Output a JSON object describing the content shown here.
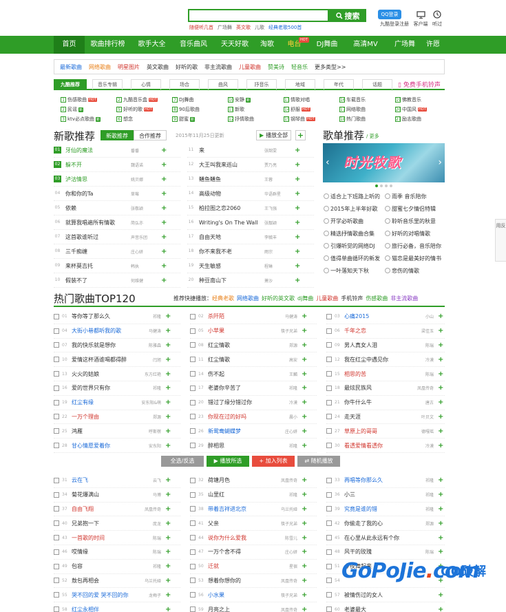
{
  "header": {
    "search_placeholder": "",
    "search_label": "搜索",
    "hot_words": [
      {
        "label": "随便听几首",
        "color": "red"
      },
      {
        "label": "广场舞",
        "color": "gray"
      },
      {
        "label": "英文歌",
        "color": "red"
      },
      {
        "label": "儿歌",
        "color": "gray"
      },
      {
        "label": "经典老歌500首",
        "color": "blue"
      }
    ],
    "qq_btn": "QQ登录",
    "tools": [
      {
        "top": "",
        "label": "九酷登录"
      },
      {
        "top": "",
        "label": "注册"
      },
      {
        "top": "",
        "label": "客户端"
      },
      {
        "top": "",
        "label": "听过"
      }
    ]
  },
  "nav": {
    "items": [
      "首页",
      "歌曲排行榜",
      "歌手大全",
      "音乐曲风",
      "天天好歌",
      "淘歌",
      "电台",
      "DJ舞曲",
      "高清MV",
      "广场舞",
      "许愿"
    ],
    "hot_label": "HOT"
  },
  "category_bar": [
    {
      "label": "最新歌曲",
      "color": "blue"
    },
    {
      "label": "网络歌曲",
      "color": "orange"
    },
    {
      "label": "明星图片",
      "color": "red"
    },
    {
      "label": "英文歌曲",
      "color": "gray"
    },
    {
      "label": "好听的歌",
      "color": "gray"
    },
    {
      "label": "非主流歌曲",
      "color": "gray"
    },
    {
      "label": "儿童歌曲",
      "color": "red"
    },
    {
      "label": "赞美诗",
      "color": "green"
    },
    {
      "label": "轻音乐",
      "color": "green"
    },
    {
      "label": "更多类型>>",
      "color": "gray"
    }
  ],
  "sub_tabs": [
    "九酷推荐",
    "音乐专辑",
    "心情",
    "场合",
    "曲风",
    "抒音乐",
    "地域",
    "年代",
    "话题"
  ],
  "phone_ring": "免费手机铃声",
  "channels": [
    [
      "1",
      "伤感歌曲",
      "tag",
      "",
      "2",
      "九酷音乐盒",
      "tag",
      "",
      "7",
      "DJ舞曲",
      "",
      "",
      "10",
      "安静",
      "g",
      "",
      "13",
      "情歌对唱",
      "",
      "",
      "16",
      "车载音乐",
      "",
      "",
      "19",
      "佛教音乐",
      "",
      ""
    ],
    [
      "2",
      "民谣",
      "g",
      "",
      "5",
      "好听的歌",
      "tag",
      "",
      "8",
      "90后歌曲",
      "",
      "",
      "11",
      "新歌",
      "",
      "",
      "14",
      "舒服",
      "tag",
      "",
      "17",
      "网络歌曲",
      "",
      "",
      "20",
      "中国风",
      "tag",
      ""
    ],
    [
      "3",
      "ktv必点歌曲",
      "g",
      "",
      "6",
      "想念",
      "",
      "",
      "9",
      "甜蜜",
      "g",
      "",
      "12",
      "抒情歌曲",
      "",
      "",
      "15",
      "钢琴曲",
      "tag",
      "",
      "18",
      "热门歌曲",
      "",
      "",
      "21",
      "励志歌曲",
      "",
      ""
    ]
  ],
  "channel_tag": "HOT",
  "channel_gtag": "新",
  "new_songs": {
    "title": "新歌推荐",
    "tabs": [
      "新歌推荐",
      "合作推荐"
    ],
    "date": "2015年11月25日更新",
    "play_all": "播放全部",
    "left": [
      {
        "n": "01",
        "t": "牙仙的魔法",
        "a": "番番",
        "c": "green"
      },
      {
        "n": "02",
        "t": "躲不开",
        "a": "魏语诺",
        "c": "green"
      },
      {
        "n": "03",
        "t": "泸沽情思",
        "a": "姚贝娜",
        "c": "green"
      },
      {
        "n": "04",
        "t": "你和你的Ta",
        "a": "草莓",
        "c": ""
      },
      {
        "n": "05",
        "t": "依赖",
        "a": "张敬颖",
        "c": ""
      },
      {
        "n": "06",
        "t": "就算我唱遍所有情歌",
        "a": "简弘亦",
        "c": ""
      },
      {
        "n": "07",
        "t": "这首歌谁听过",
        "a": "声音乐团",
        "c": ""
      },
      {
        "n": "08",
        "t": "三千痴缠",
        "a": "庄心妍",
        "c": ""
      },
      {
        "n": "09",
        "t": "来杯莫吉托",
        "a": "韩执",
        "c": ""
      },
      {
        "n": "10",
        "t": "假装不了",
        "a": "何维健",
        "c": ""
      }
    ],
    "right": [
      {
        "n": "11",
        "t": "来",
        "a": "张韶雯",
        "c": ""
      },
      {
        "n": "12",
        "t": "大王叫我来巡山",
        "a": "贾乃亮",
        "c": ""
      },
      {
        "n": "13",
        "t": "鳝鱼鳝鱼",
        "a": "王蓉",
        "c": ""
      },
      {
        "n": "14",
        "t": "高级动物",
        "a": "华语群星",
        "c": ""
      },
      {
        "n": "15",
        "t": "柏拉图之恋2060",
        "a": "王飞强",
        "c": ""
      },
      {
        "n": "16",
        "t": "Writing's On The Wall",
        "a": "张靓颖",
        "c": ""
      },
      {
        "n": "17",
        "t": "自由天地",
        "a": "李毓丰",
        "c": ""
      },
      {
        "n": "18",
        "t": "你不来我不老",
        "a": "雨宗",
        "c": ""
      },
      {
        "n": "19",
        "t": "天生敏感",
        "a": "程琳",
        "c": ""
      },
      {
        "n": "20",
        "t": "种豆南山下",
        "a": "萧沙",
        "c": ""
      }
    ]
  },
  "playlists": {
    "title": "歌单推荐",
    "more": "/ 更多",
    "banner_text": "时光牧歌",
    "items": [
      [
        "适合上下班路上听的",
        "雨季 音乐陪你"
      ],
      [
        "2015年上半年好歌",
        "甜蜜七夕情侣特辑"
      ],
      [
        "开学必听歌曲",
        "聆听音乐里的秋意"
      ],
      [
        "精选抒情歌曲合集",
        "好听的对唱情歌"
      ],
      [
        "引爆听觉的网络DJ",
        "旅行必备，音乐陪你"
      ],
      [
        "值得单曲循环的新发",
        "猫恋是最美好的情书"
      ],
      [
        "一叶落知天下秋",
        "悲伤的情歌"
      ]
    ]
  },
  "hot_songs": {
    "title": "热门歌曲TOP120",
    "quick_label": "推荐快捷播放：",
    "quick": [
      {
        "label": "经典老歌",
        "color": "orange"
      },
      {
        "label": "网络歌曲",
        "color": "blue"
      },
      {
        "label": "好听的英文歌",
        "color": "green"
      },
      {
        "label": "dj舞曲",
        "color": "green"
      },
      {
        "label": "儿童歌曲",
        "color": "red"
      },
      {
        "label": "手机铃声",
        "color": "gray"
      },
      {
        "label": "伤感歌曲",
        "color": "green"
      },
      {
        "label": "非主流歌曲",
        "color": "purple"
      }
    ],
    "col1": [
      {
        "n": "01",
        "t": "等你等了那么久",
        "a": "祁隆",
        "c": ""
      },
      {
        "n": "04",
        "t": "大街小巷都听我的歌",
        "a": "马健涛",
        "c": "blue"
      },
      {
        "n": "07",
        "t": "我的快乐就是想你",
        "a": "陈雅森",
        "c": ""
      },
      {
        "n": "10",
        "t": "爱情这杯酒谁喝都得醉",
        "a": "闫旭",
        "c": ""
      },
      {
        "n": "13",
        "t": "火火的姑娘",
        "a": "东方红艳",
        "c": ""
      },
      {
        "n": "16",
        "t": "爱的世界只有你",
        "a": "祁隆",
        "c": ""
      },
      {
        "n": "19",
        "t": "红尘有缘",
        "a": "安东阳&萌",
        "c": "blue"
      },
      {
        "n": "22",
        "t": "一万个理由",
        "a": "郑源",
        "c": "red"
      },
      {
        "n": "25",
        "t": "鸿雁",
        "a": "呼斯楞",
        "c": ""
      },
      {
        "n": "28",
        "t": "甘心情愿爱着你",
        "a": "安东阳",
        "c": "blue"
      }
    ],
    "col2": [
      {
        "n": "02",
        "t": "杀阡陌",
        "a": "马健涛",
        "c": "red"
      },
      {
        "n": "05",
        "t": "小苹果",
        "a": "筷子兄弟",
        "c": "red"
      },
      {
        "n": "08",
        "t": "红尘情歌",
        "a": "郑源",
        "c": ""
      },
      {
        "n": "11",
        "t": "红尘情歌",
        "a": "高安",
        "c": ""
      },
      {
        "n": "14",
        "t": "伤不起",
        "a": "王麟",
        "c": ""
      },
      {
        "n": "17",
        "t": "老婆你辛苦了",
        "a": "祁隆",
        "c": ""
      },
      {
        "n": "20",
        "t": "错过了缘分错过你",
        "a": "冷漠",
        "c": ""
      },
      {
        "n": "23",
        "t": "你现在过的好吗",
        "a": "晨小",
        "c": "red"
      },
      {
        "n": "26",
        "t": "新鸳鸯蝴蝶梦",
        "a": "庄心妍",
        "c": "blue"
      },
      {
        "n": "29",
        "t": "醉相思",
        "a": "祁隆",
        "c": ""
      }
    ],
    "col3": [
      {
        "n": "03",
        "t": "心痛2015",
        "a": "小山",
        "c": "blue"
      },
      {
        "n": "06",
        "t": "千年之恋",
        "a": "梁佳玉",
        "c": "red"
      },
      {
        "n": "09",
        "t": "男人真女人泪",
        "a": "陈瑞",
        "c": ""
      },
      {
        "n": "12",
        "t": "我在红尘中遇见你",
        "a": "冷漠",
        "c": ""
      },
      {
        "n": "15",
        "t": "相思的苦",
        "a": "陈瑞",
        "c": "red"
      },
      {
        "n": "18",
        "t": "最炫民族风",
        "a": "凤凰传奇",
        "c": ""
      },
      {
        "n": "21",
        "t": "你牛什么牛",
        "a": "唐古",
        "c": ""
      },
      {
        "n": "24",
        "t": "走天涯",
        "a": "叶贝文",
        "c": ""
      },
      {
        "n": "27",
        "t": "草原上的哥哥",
        "a": "德嘎瑶",
        "c": "red"
      },
      {
        "n": "30",
        "t": "看透爱情看透你",
        "a": "冷漠",
        "c": "red"
      }
    ],
    "actions": [
      "全选/反选",
      "播放所选",
      "加入列表",
      "随机播放"
    ],
    "col1b": [
      {
        "n": "31",
        "t": "云在飞",
        "a": "云飞",
        "c": "blue"
      },
      {
        "n": "34",
        "t": "菊花爆满山",
        "a": "马博",
        "c": ""
      },
      {
        "n": "37",
        "t": "自由飞翔",
        "a": "凤凰传奇",
        "c": "red"
      },
      {
        "n": "40",
        "t": "兄弟抱一下",
        "a": "庞龙",
        "c": ""
      },
      {
        "n": "43",
        "t": "一首歌的时间",
        "a": "陈瑞",
        "c": "red"
      },
      {
        "n": "46",
        "t": "哎情缘",
        "a": "陈瑞",
        "c": ""
      },
      {
        "n": "49",
        "t": "包容",
        "a": "祁隆",
        "c": ""
      },
      {
        "n": "52",
        "t": "敖包再相会",
        "a": "乌兰托娅",
        "c": ""
      },
      {
        "n": "55",
        "t": "哭不回的爱 哭不回的你",
        "a": "龙梅子",
        "c": "blue"
      },
      {
        "n": "58",
        "t": "红尘永相伴",
        "a": "",
        "c": "blue"
      }
    ],
    "col2b": [
      {
        "n": "32",
        "t": "荷塘月色",
        "a": "凤凰传奇",
        "c": ""
      },
      {
        "n": "35",
        "t": "山里红",
        "a": "祁隆",
        "c": ""
      },
      {
        "n": "38",
        "t": "带着吉祥进北京",
        "a": "乌兰托娅",
        "c": "blue"
      },
      {
        "n": "41",
        "t": "父亲",
        "a": "筷子兄弟",
        "c": ""
      },
      {
        "n": "44",
        "t": "说你为什么爱我",
        "a": "陈雪儿",
        "c": "red"
      },
      {
        "n": "47",
        "t": "一万个舍不得",
        "a": "庄心妍",
        "c": ""
      },
      {
        "n": "50",
        "t": "迁就",
        "a": "星宿",
        "c": "red"
      },
      {
        "n": "53",
        "t": "想着你想你的",
        "a": "凤凰传奇",
        "c": ""
      },
      {
        "n": "56",
        "t": "小水果",
        "a": "筷子兄弟",
        "c": "blue"
      },
      {
        "n": "59",
        "t": "月亮之上",
        "a": "凤凰传奇",
        "c": ""
      }
    ],
    "col3b": [
      {
        "n": "33",
        "t": "再唱等你那么久",
        "a": "祁隆",
        "c": "blue"
      },
      {
        "n": "36",
        "t": "小三",
        "a": "祁隆",
        "c": ""
      },
      {
        "n": "39",
        "t": "究竟是谁的错",
        "a": "祁隆",
        "c": "blue"
      },
      {
        "n": "42",
        "t": "你偷走了我的心",
        "a": "郑源",
        "c": ""
      },
      {
        "n": "45",
        "t": "在心里从此永远有个你",
        "a": "",
        "c": ""
      },
      {
        "n": "48",
        "t": "风干的玫瑰",
        "a": "陈瑞",
        "c": ""
      },
      {
        "n": "51",
        "t": "今夜舞起来",
        "a": "",
        "c": ""
      },
      {
        "n": "54",
        "t": "",
        "a": "",
        "c": ""
      },
      {
        "n": "57",
        "t": "被情伤过的女人",
        "a": "",
        "c": ""
      },
      {
        "n": "60",
        "t": "老婆最大",
        "a": "",
        "c": ""
      }
    ]
  },
  "watermark": {
    "a": "GoPoJie",
    "dot": ".",
    "b": "com",
    "cn": "GO破解"
  },
  "side_tab": "用反"
}
